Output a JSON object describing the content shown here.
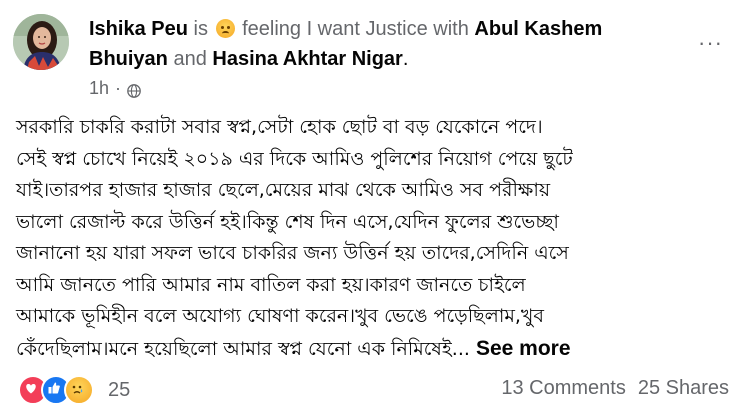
{
  "post": {
    "author": "Ishika Peu",
    "is_text": "is",
    "feeling_icon": "disappointed-face-emoji",
    "feeling_text": "feeling I want Justice with",
    "tagged_1": "Abul Kashem Bhuiyan",
    "and_text": "and",
    "tagged_2": "Hasina Akhtar Nigar",
    "period": ".",
    "time": "1h",
    "dot": "·",
    "privacy_icon": "globe-icon",
    "more_icon": "···",
    "body": "সরকারি চাকরি করাটা সবার স্বপ্ন,সেটা হোক ছোট বা বড় যেকোনে পদে।\nসেই স্বপ্ন চোখে নিয়েই ২০১৯ এর দিকে আমিও পুলিশের নিয়োগ পেয়ে ছুটে\nযাই।তারপর হাজার হাজার ছেলে,মেয়ের মাঝ থেকে আমিও সব পরীক্ষায়\nভালো রেজাল্ট করে উত্তির্ন হই।কিন্তু শেষ দিন এসে,যেদিন ফুলের শুভেচ্ছা\nজানানো হয় যারা সফল ভাবে চাকরির জন্য উত্তির্ন হয় তাদের,সেদিনি এসে\nআমি জানতে পারি আমার নাম বাতিল করা হয়।কারণ জানতে চাইলে\nআমাকে ভূমিহীন বলে অযোগ্য ঘোষণা করেন।খুব ভেঙে পড়েছিলাম,খুব\nকেঁদেছিলাম।মনে হয়েছিলো আমার স্বপ্ন যেনো এক নিমিষেই...",
    "see_more": "See more"
  },
  "footer": {
    "reaction_icons": [
      "love-icon",
      "like-icon",
      "sad-icon"
    ],
    "reaction_count": "25",
    "comments": "13 Comments",
    "shares": "25 Shares"
  },
  "colors": {
    "text": "#050505",
    "muted": "#65676b",
    "love": "#f33e58",
    "like": "#1877f2",
    "sad": "#f7b125"
  }
}
